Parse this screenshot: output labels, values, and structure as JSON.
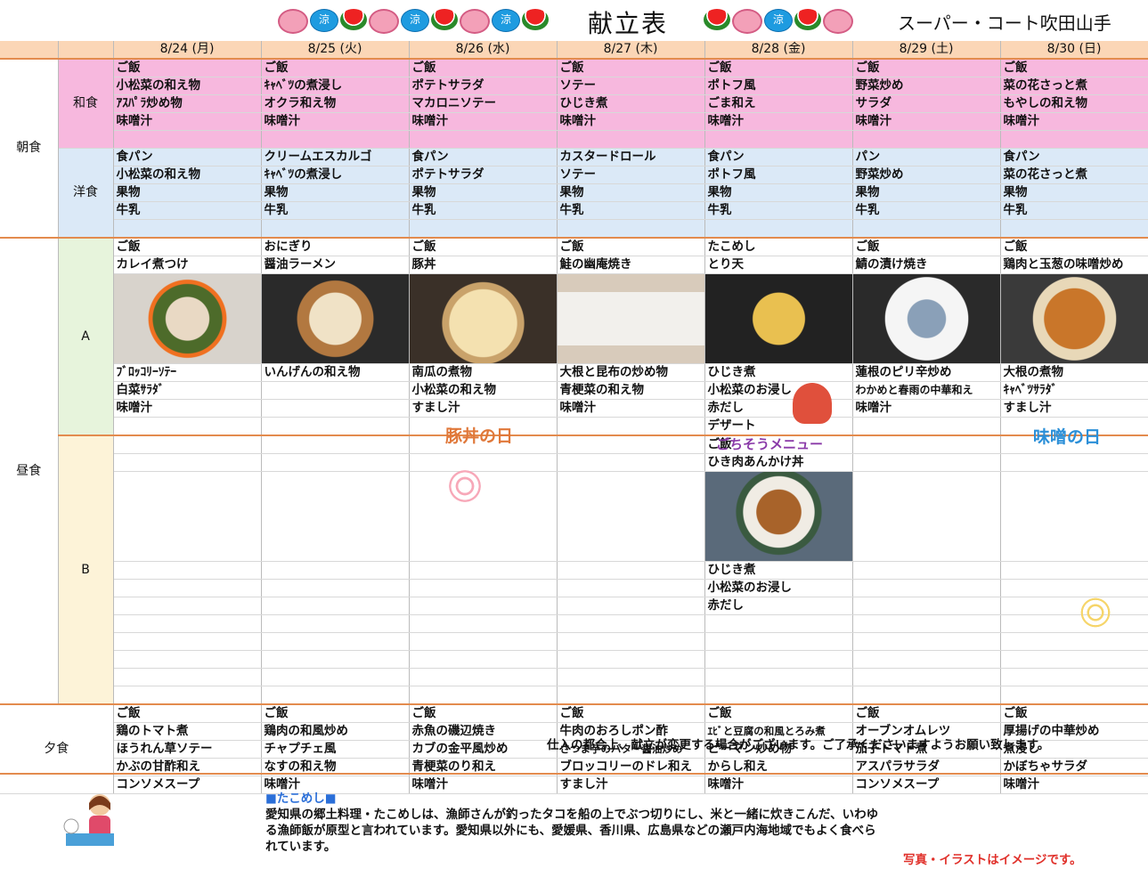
{
  "header": {
    "title": "献立表",
    "store": "スーパー・コート吹田山手",
    "deco_left": [
      "fish",
      "fan",
      "melon",
      "fish",
      "fan",
      "melon",
      "fish",
      "fan",
      "melon"
    ],
    "deco_right": [
      "melon",
      "fish",
      "fan",
      "melon",
      "fish"
    ],
    "fan_char": "涼"
  },
  "days": [
    "8/24 (月)",
    "8/25 (火)",
    "8/26 (水)",
    "8/27 (木)",
    "8/28 (金)",
    "8/29 (土)",
    "8/30 (日)"
  ],
  "meals": {
    "breakfast": "朝食",
    "lunch": "昼食",
    "dinner": "夕食"
  },
  "sections": {
    "japanese": "和食",
    "western": "洋食",
    "a": "A",
    "b": "B"
  },
  "breakfast_japanese": [
    [
      "ご飯",
      "ご飯",
      "ご飯",
      "ご飯",
      "ご飯",
      "ご飯",
      "ご飯"
    ],
    [
      "小松菜の和え物",
      "ｷｬﾍﾞﾂの煮浸し",
      "ポテトサラダ",
      "ソテー",
      "ポトフ風",
      "野菜炒め",
      "菜の花さっと煮"
    ],
    [
      "ｱｽﾊﾟﾗ炒め物",
      "オクラ和え物",
      "マカロニソテー",
      "ひじき煮",
      "ごま和え",
      "サラダ",
      "もやしの和え物"
    ],
    [
      "味噌汁",
      "味噌汁",
      "味噌汁",
      "味噌汁",
      "味噌汁",
      "味噌汁",
      "味噌汁"
    ]
  ],
  "breakfast_western": [
    [
      "食パン",
      "クリームエスカルゴ",
      "食パン",
      "カスタードロール",
      "食パン",
      "パン",
      "食パン"
    ],
    [
      "小松菜の和え物",
      "ｷｬﾍﾞﾂの煮浸し",
      "ポテトサラダ",
      "ソテー",
      "ポトフ風",
      "野菜炒め",
      "菜の花さっと煮"
    ],
    [
      "果物",
      "果物",
      "果物",
      "果物",
      "果物",
      "果物",
      "果物"
    ],
    [
      "牛乳",
      "牛乳",
      "牛乳",
      "牛乳",
      "牛乳",
      "牛乳",
      "牛乳"
    ]
  ],
  "lunch_a_top": [
    [
      "ご飯",
      "おにぎり",
      "ご飯",
      "ご飯",
      "たこめし",
      "ご飯",
      "ご飯"
    ],
    [
      "カレイ煮つけ",
      "醤油ラーメン",
      "豚丼",
      "鮭の幽庵焼き",
      "とり天",
      "鯖の漬け焼き",
      "鶏肉と玉葱の味噌炒め"
    ]
  ],
  "lunch_a_bottom": [
    [
      "ﾌﾞﾛｯｺﾘｰｿﾃｰ",
      "いんげんの和え物",
      "南瓜の煮物",
      "大根と昆布の炒め物",
      "ひじき煮",
      "蓮根のピリ辛炒め",
      "大根の煮物"
    ],
    [
      "白菜ｻﾗﾀﾞ",
      "",
      "小松菜の和え物",
      "青梗菜の和え物",
      "小松菜のお浸し",
      "わかめと春雨の中華和え",
      "ｷｬﾍﾞﾂｻﾗﾀﾞ"
    ],
    [
      "味噌汁",
      "",
      "すまし汁",
      "味噌汁",
      "赤だし",
      "味噌汁",
      "すまし汁"
    ],
    [
      "",
      "",
      "",
      "",
      "デザート",
      "",
      ""
    ]
  ],
  "lunch_b_top": [
    "ご飯",
    "ひき肉あんかけ丼"
  ],
  "lunch_b_bottom": [
    "ひじき煮",
    "小松菜のお浸し",
    "赤だし"
  ],
  "dinner": [
    [
      "ご飯",
      "ご飯",
      "ご飯",
      "ご飯",
      "ご飯",
      "ご飯",
      "ご飯"
    ],
    [
      "鶏のトマト煮",
      "鶏肉の和風炒め",
      "赤魚の磯辺焼き",
      "牛肉のおろしポン酢",
      "ｴﾋﾞと豆腐の和風とろみ煮",
      "オーブンオムレツ",
      "厚揚げの中華炒め"
    ],
    [
      "ほうれん草ソテー",
      "チャプチェ風",
      "カブの金平風炒め",
      "さつま芋のバター醤油炒め",
      "ピーマン炒め物",
      "茄子トマト煮",
      "煮浸し"
    ],
    [
      "かぶの甘酢和え",
      "なすの和え物",
      "青梗菜のり和え",
      "ブロッコリーのドレ和え",
      "からし和え",
      "アスパラサラダ",
      "かぼちゃサラダ"
    ],
    [
      "コンソメスープ",
      "味噌汁",
      "味噌汁",
      "すまし汁",
      "味噌汁",
      "コンソメスープ",
      "味噌汁"
    ]
  ],
  "banners": {
    "butadon": "豚丼の日",
    "gochisou": "ごちそうメニュー",
    "miso": "味噌の日"
  },
  "colors": {
    "butadon": "#e0783a",
    "gochisou": "#8a3aa8",
    "miso": "#2b8fd8",
    "accent_border": "#e38b4e",
    "footnote_red": "#e0302a"
  },
  "notice": "仕入の都合上、献立が変更する場合がございます。ご了承くださいますようお願い致します。",
  "column": {
    "heading": "■たこめし■",
    "lines": [
      "愛知県の郷土料理・たこめしは、漁師さんが釣ったタコを船の上でぶつ切りにし、米と一緒に炊きこんだ、いわゆ",
      "る漁師飯が原型と言われています。愛知県以外にも、愛媛県、香川県、広島県などの瀬戸内海地域でもよく食べら",
      "れています。"
    ]
  },
  "image_note": "写真・イラストはイメージです。"
}
